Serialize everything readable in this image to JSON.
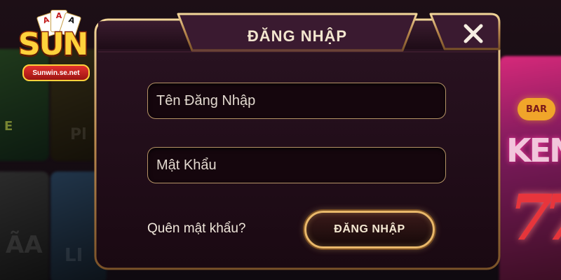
{
  "brand": {
    "logo_word": "SUN",
    "logo_domain": "Sunwin.se.net",
    "logo_cards": [
      "A",
      "A",
      "A"
    ]
  },
  "background": {
    "letter_1": "E",
    "letter_2": "ÃA",
    "letter_3": "Pl",
    "letter_4": "LI",
    "bar_sign": "BAR",
    "ken_sign": "KEN",
    "seven_sign": "77"
  },
  "dialog": {
    "title": "ĐĂNG NHẬP",
    "close_icon": "close-icon",
    "username_placeholder": "Tên Đăng Nhập",
    "username_value": "",
    "password_placeholder": "Mật Khẩu",
    "password_value": "",
    "forgot_password_label": "Quên mật khẩu?",
    "login_button_label": "ĐĂNG NHẬP"
  },
  "colors": {
    "panel_bg": "#1e0c17",
    "gold_border": "#caa066",
    "button_border": "#e9b86a",
    "text_light": "#f2e6cf"
  }
}
